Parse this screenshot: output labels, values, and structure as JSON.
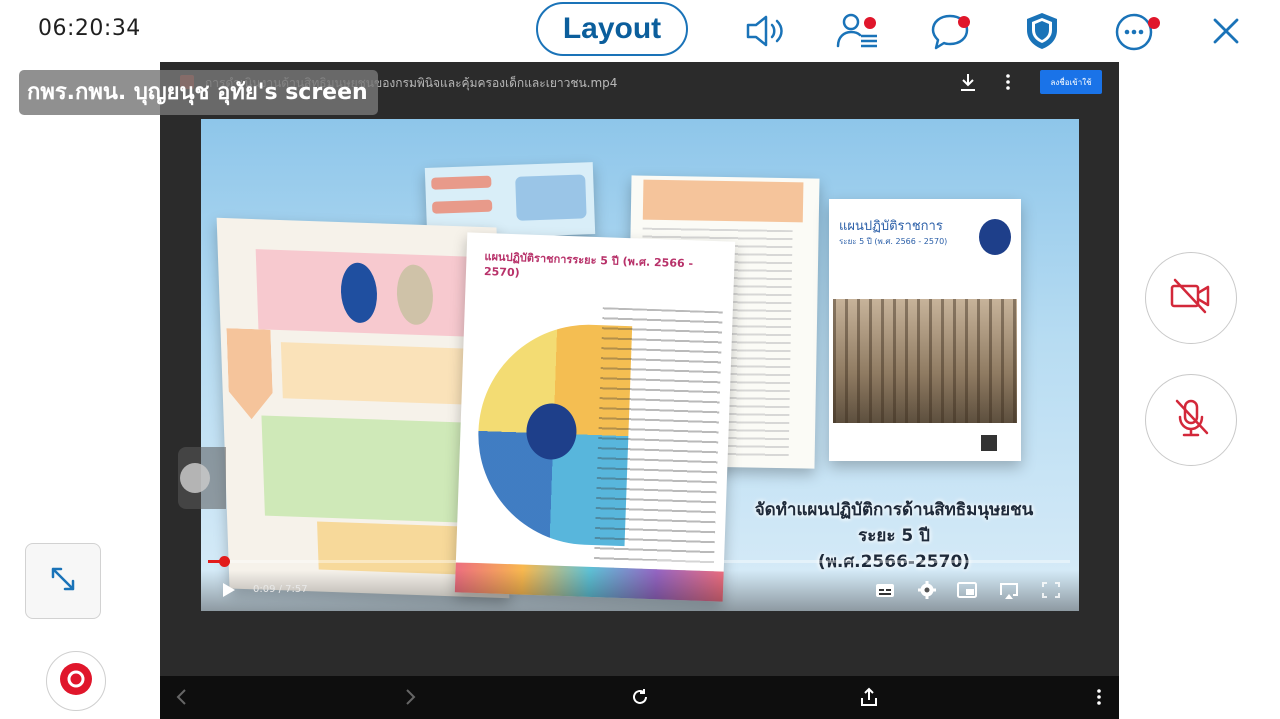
{
  "status": {
    "time": "06:20:34"
  },
  "toolbar": {
    "layout_label": "Layout",
    "icons": [
      "speaker-icon",
      "participants-icon",
      "chat-icon",
      "shield-icon",
      "more-icon",
      "close-icon"
    ],
    "accent_color": "#1a73b8",
    "badge_color": "#e0162b"
  },
  "share": {
    "presenter_label": "กพร.กพน. บุญยนุช อุทัย's screen",
    "file_name": "การดำเนินงานด้านสิทธิมนุษยชนของกรมพินิจและคุ้มครองเด็กและเยาวชน.mp4",
    "signin_label": "ลงชื่อเข้าใช้"
  },
  "video": {
    "caption_line1": "จัดทำแผนปฏิบัติการด้านสิทธิมนุษยชน",
    "caption_line2": "ระยะ 5 ปี",
    "caption_line3": "(พ.ศ.2566-2570)",
    "doc_right_title": "แผนปฏิบัติราชการ",
    "doc_right_sub": "ระยะ 5 ปี (พ.ศ. 2566 - 2570)",
    "doc_center_title": "แผนปฏิบัติราชการระยะ 5 ปี (พ.ศ. 2566 - 2570)",
    "current_time": "0:09",
    "duration": "7:57",
    "time_display": "0:09 / 7:57",
    "progress_fraction": 0.019
  },
  "controls": {
    "icons": [
      "play-icon",
      "subtitles-icon",
      "settings-icon",
      "miniplayer-icon",
      "cast-icon",
      "fullscreen-icon"
    ]
  },
  "browser_bar": {
    "icons": [
      "back-icon",
      "forward-icon",
      "reload-icon",
      "share-icon",
      "menu-icon"
    ]
  },
  "side": {
    "icons": [
      "camera-off-icon",
      "mic-off-icon",
      "expand-icon",
      "record-icon"
    ]
  }
}
